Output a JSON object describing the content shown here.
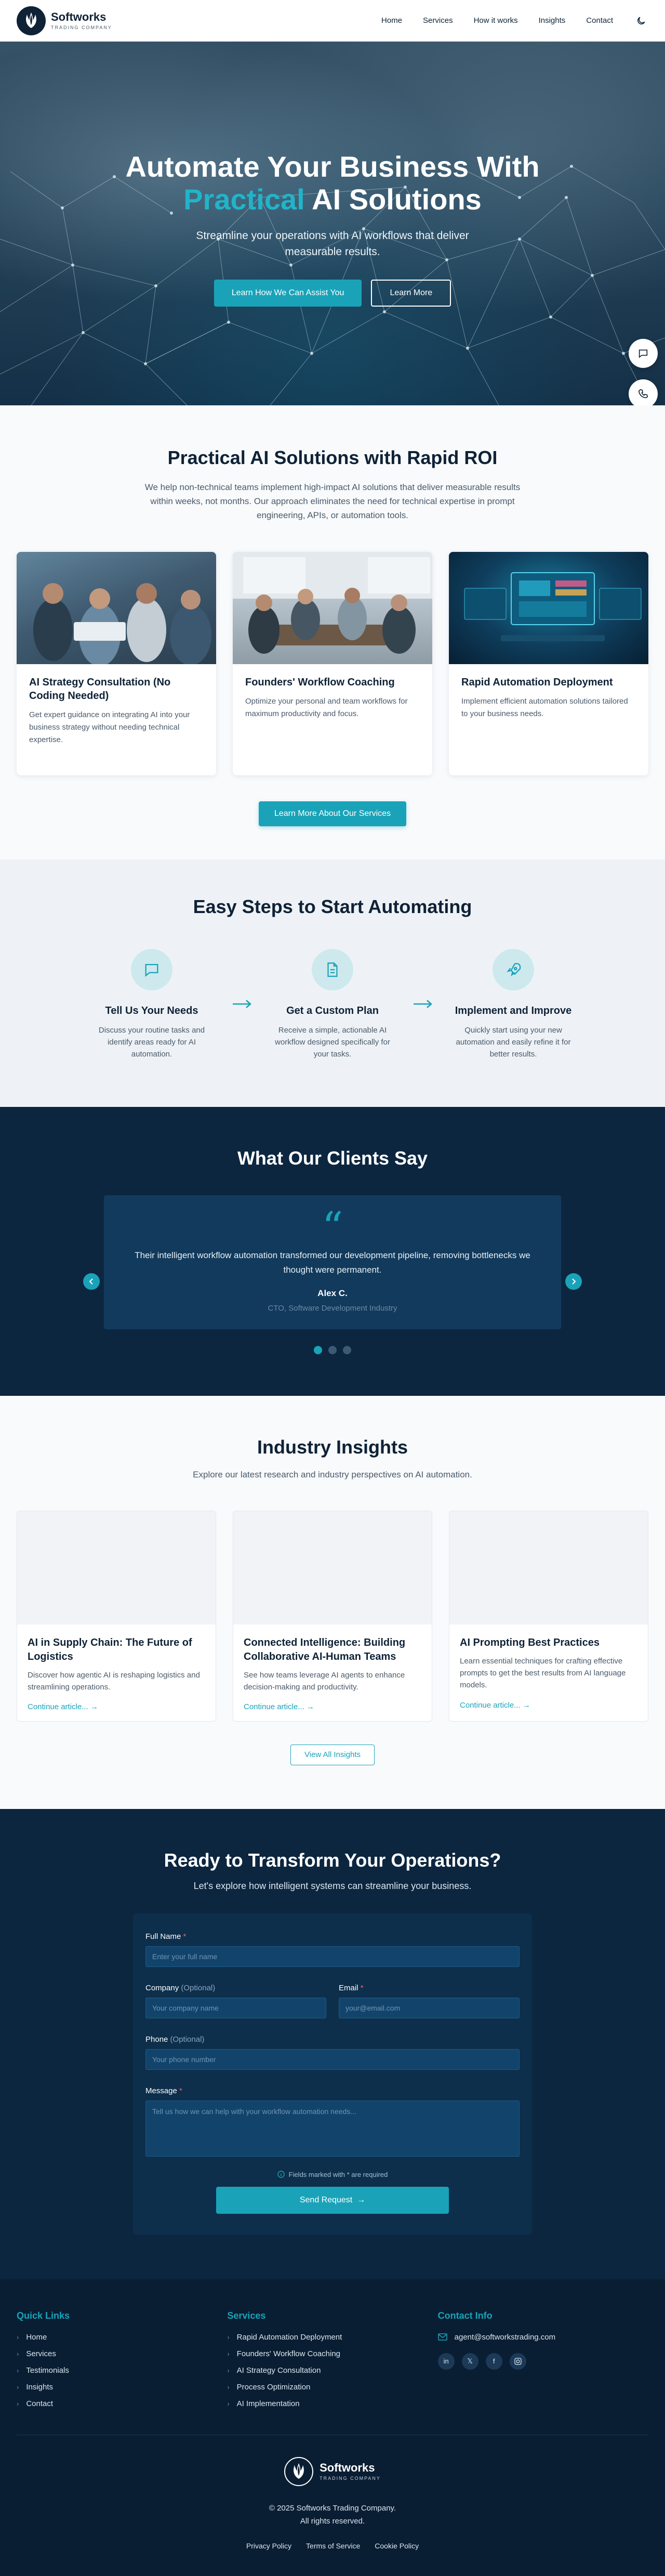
{
  "nav": {
    "brand": "Softworks",
    "brand_sub": "TRADING COMPANY",
    "links": [
      "Home",
      "Services",
      "How it works",
      "Insights",
      "Contact"
    ]
  },
  "hero": {
    "title_line1": "Automate Your Business With",
    "title_accent": "Practical",
    "title_rest": " AI Solutions",
    "subtitle": "Streamline your operations with AI workflows that deliver measurable results.",
    "cta_primary": "Learn How We Can Assist You",
    "cta_secondary": "Learn More"
  },
  "roi": {
    "title": "Practical AI Solutions with Rapid ROI",
    "description": "We help non-technical teams implement high-impact AI solutions that deliver measurable results within weeks, not months. Our approach eliminates the need for technical expertise in prompt engineering, APIs, or automation tools.",
    "cards": [
      {
        "title": "AI Strategy Consultation (No Coding Needed)",
        "desc": "Get expert guidance on integrating AI into your business strategy without needing technical expertise."
      },
      {
        "title": "Founders' Workflow Coaching",
        "desc": "Optimize your personal and team workflows for maximum productivity and focus."
      },
      {
        "title": "Rapid Automation Deployment",
        "desc": "Implement efficient automation solutions tailored to your business needs."
      }
    ],
    "cta": "Learn More About Our Services"
  },
  "steps": {
    "title": "Easy Steps to Start Automating",
    "items": [
      {
        "title": "Tell Us Your Needs",
        "desc": "Discuss your routine tasks and identify areas ready for AI automation."
      },
      {
        "title": "Get a Custom Plan",
        "desc": "Receive a simple, actionable AI workflow designed specifically for your tasks."
      },
      {
        "title": "Implement and Improve",
        "desc": "Quickly start using your new automation and easily refine it for better results."
      }
    ]
  },
  "testimonials": {
    "title": "What Our Clients Say",
    "quote": "Their intelligent workflow automation transformed our development pipeline, removing bottlenecks we thought were permanent.",
    "name": "Alex C.",
    "role": "CTO, Software Development Industry",
    "active_index": 0,
    "count": 3
  },
  "insights": {
    "title": "Industry Insights",
    "subtitle": "Explore our latest research and industry perspectives on AI automation.",
    "articles": [
      {
        "title": "AI in Supply Chain: The Future of Logistics",
        "desc": "Discover how agentic AI is reshaping logistics and streamlining operations.",
        "link": "Continue article..."
      },
      {
        "title": "Connected Intelligence: Building Collaborative AI-Human Teams",
        "desc": "See how teams leverage AI agents to enhance decision-making and productivity.",
        "link": "Continue article..."
      },
      {
        "title": "AI Prompting Best Practices",
        "desc": "Learn essential techniques for crafting effective prompts to get the best results from AI language models.",
        "link": "Continue article..."
      }
    ],
    "cta": "View All Insights"
  },
  "contact": {
    "title": "Ready to Transform Your Operations?",
    "subtitle": "Let's explore how intelligent systems can streamline your business.",
    "fields": {
      "name_label": "Full Name",
      "name_placeholder": "Enter your full name",
      "company_label": "Company",
      "company_placeholder": "Your company name",
      "email_label": "Email",
      "email_placeholder": "your@email.com",
      "phone_label": "Phone",
      "phone_placeholder": "Your phone number",
      "message_label": "Message",
      "message_placeholder": "Tell us how we can help with your workflow automation needs...",
      "optional": "(Optional)",
      "required_mark": "*"
    },
    "note": "Fields marked with * are required",
    "submit": "Send Request"
  },
  "footer": {
    "quick_links_title": "Quick Links",
    "quick_links": [
      "Home",
      "Services",
      "Testimonials",
      "Insights",
      "Contact"
    ],
    "services_title": "Services",
    "services": [
      "Rapid Automation Deployment",
      "Founders' Workflow Coaching",
      "AI Strategy Consultation",
      "Process Optimization",
      "AI Implementation"
    ],
    "contact_title": "Contact Info",
    "email": "agent@softworkstrading.com",
    "socials": [
      "linkedin-icon",
      "x-icon",
      "facebook-icon",
      "instagram-icon"
    ],
    "copyright_line1": "© 2025 Softworks Trading Company.",
    "copyright_line2": "All rights reserved.",
    "legal": [
      "Privacy Policy",
      "Terms of Service",
      "Cookie Policy"
    ]
  },
  "colors": {
    "accent": "#1aa3b8",
    "navy": "#0c2640",
    "text": "#0f2236"
  }
}
